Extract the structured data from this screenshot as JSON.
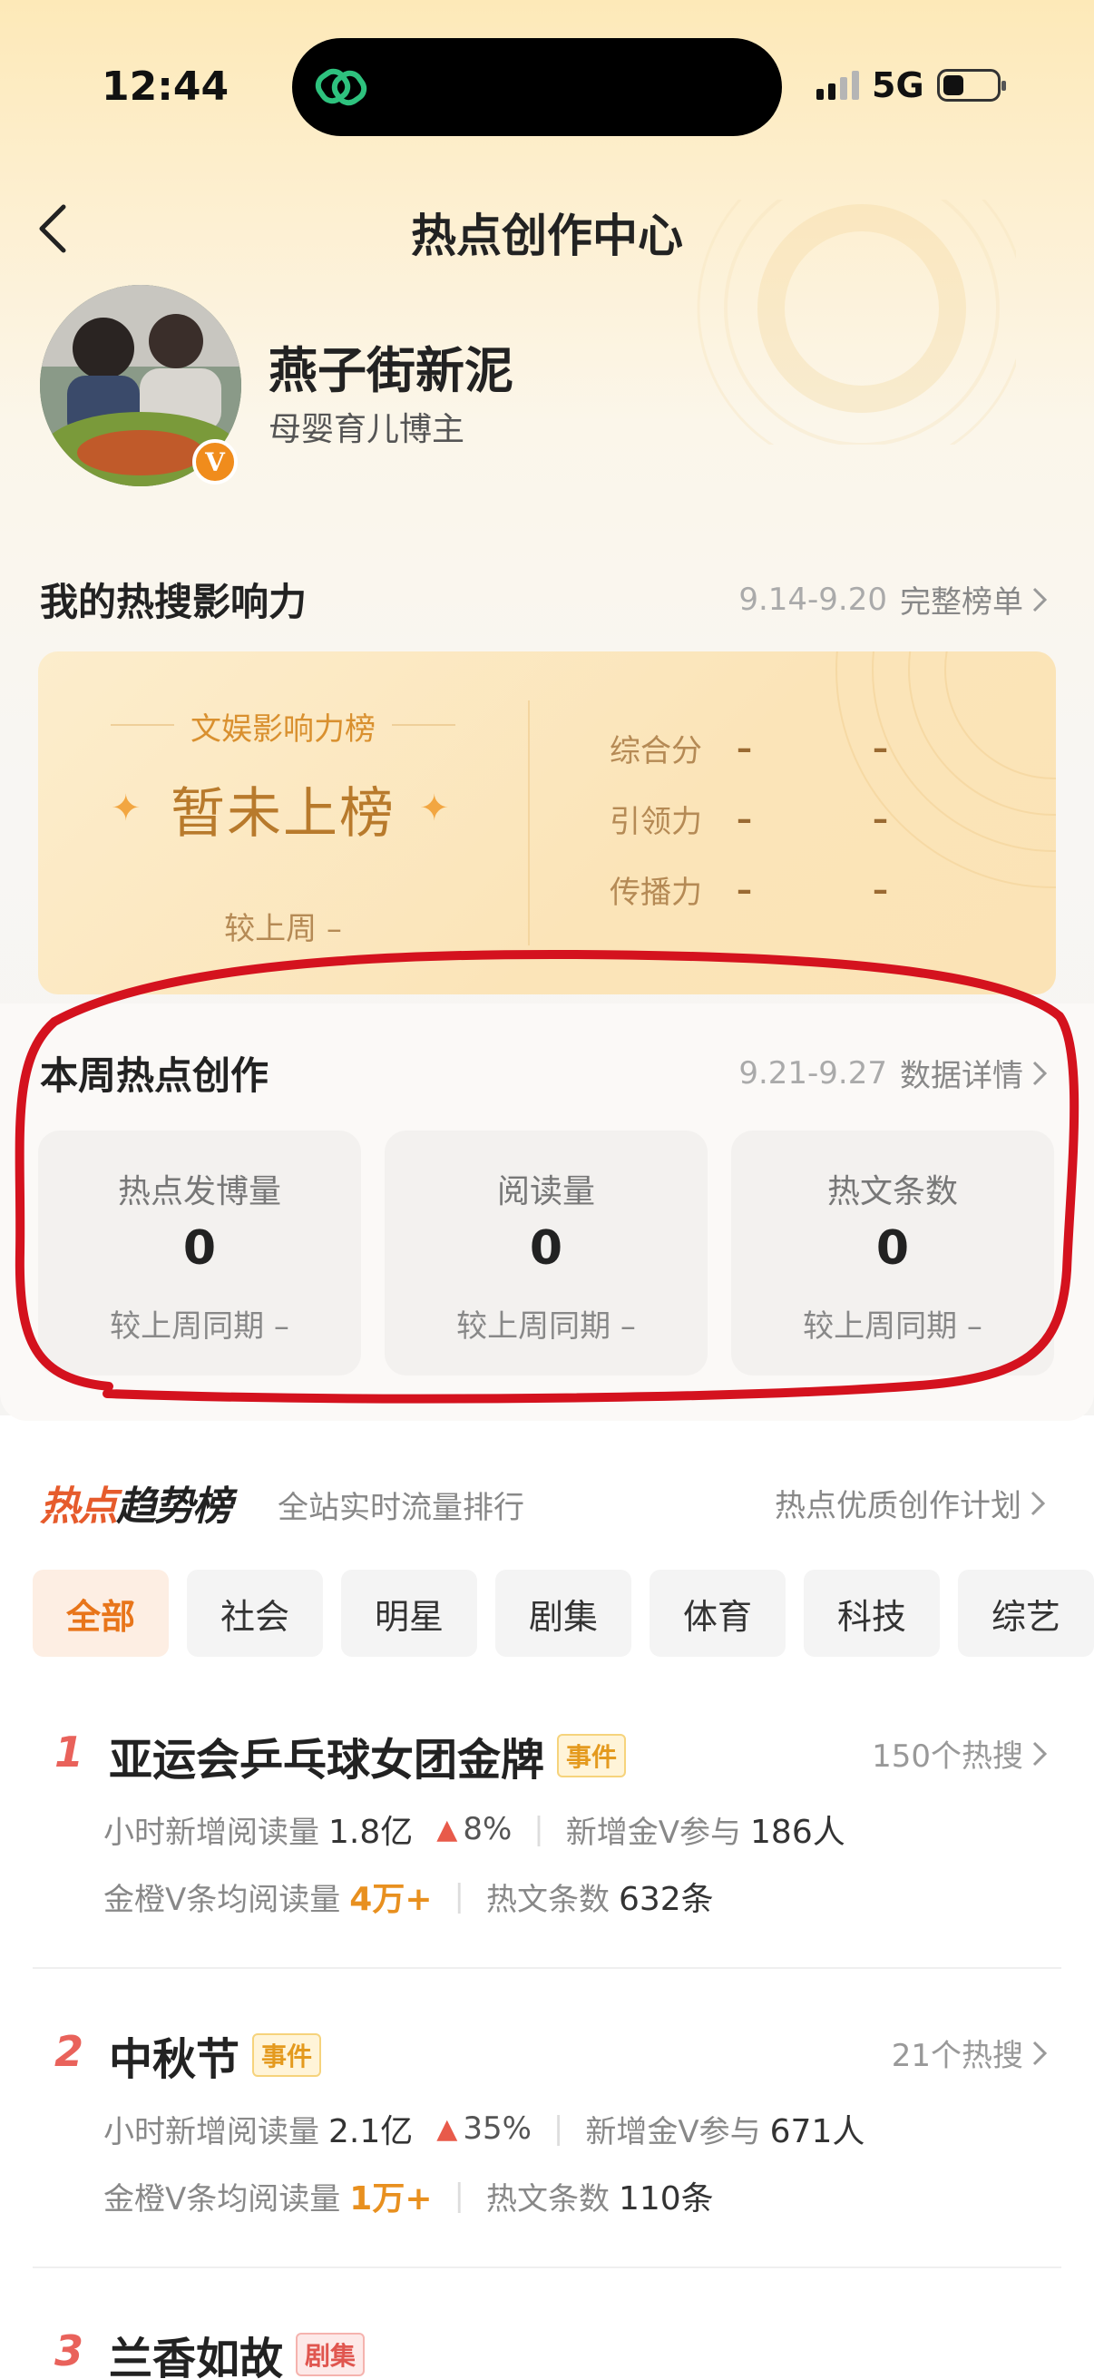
{
  "status_bar": {
    "time": "12:44",
    "network": "5G"
  },
  "nav": {
    "title": "热点创作中心"
  },
  "profile": {
    "name": "燕子街新泥",
    "tag": "母婴育儿博主",
    "badge": "V"
  },
  "influence": {
    "title": "我的热搜影响力",
    "date_range": "9.14-9.20",
    "link": "完整榜单",
    "board_label": "文娱影响力榜",
    "status": "暂未上榜",
    "compare": "较上周 –",
    "metrics": [
      {
        "label": "综合分",
        "v1": "–",
        "v2": "–"
      },
      {
        "label": "引领力",
        "v1": "–",
        "v2": "–"
      },
      {
        "label": "传播力",
        "v1": "–",
        "v2": "–"
      }
    ]
  },
  "weekly": {
    "title": "本周热点创作",
    "date_range": "9.21-9.27",
    "link": "数据详情",
    "cards": [
      {
        "label": "热点发博量",
        "value": "0",
        "compare": "较上周同期 –"
      },
      {
        "label": "阅读量",
        "value": "0",
        "compare": "较上周同期 –"
      },
      {
        "label": "热文条数",
        "value": "0",
        "compare": "较上周同期 –"
      }
    ]
  },
  "trend": {
    "logo_a": "热点",
    "logo_b": "趋势榜",
    "subtitle": "全站实时流量排行",
    "link": "热点优质创作计划",
    "tabs": [
      "全部",
      "社会",
      "明星",
      "剧集",
      "体育",
      "科技",
      "综艺"
    ],
    "items": [
      {
        "rank": "1",
        "title": "亚运会乒乓球女团金牌",
        "tag": "事件",
        "count": "150个热搜",
        "hour_label": "小时新增阅读量",
        "hour_value": "1.8亿",
        "pct": "8%",
        "gold_label": "新增金V参与",
        "gold_value": "186人",
        "avg_label": "金橙V条均阅读量",
        "avg_value": "4万+",
        "hot_label": "热文条数",
        "hot_value": "632条"
      },
      {
        "rank": "2",
        "title": "中秋节",
        "tag": "事件",
        "count": "21个热搜",
        "hour_label": "小时新增阅读量",
        "hour_value": "2.1亿",
        "pct": "35%",
        "gold_label": "新增金V参与",
        "gold_value": "671人",
        "avg_label": "金橙V条均阅读量",
        "avg_value": "1万+",
        "hot_label": "热文条数",
        "hot_value": "110条"
      },
      {
        "rank": "3",
        "title": "兰香如故",
        "tag": "剧集"
      }
    ]
  },
  "colors": {
    "accent": "#e8751a",
    "rank": "#e9625b",
    "annotation": "#d4121e"
  }
}
